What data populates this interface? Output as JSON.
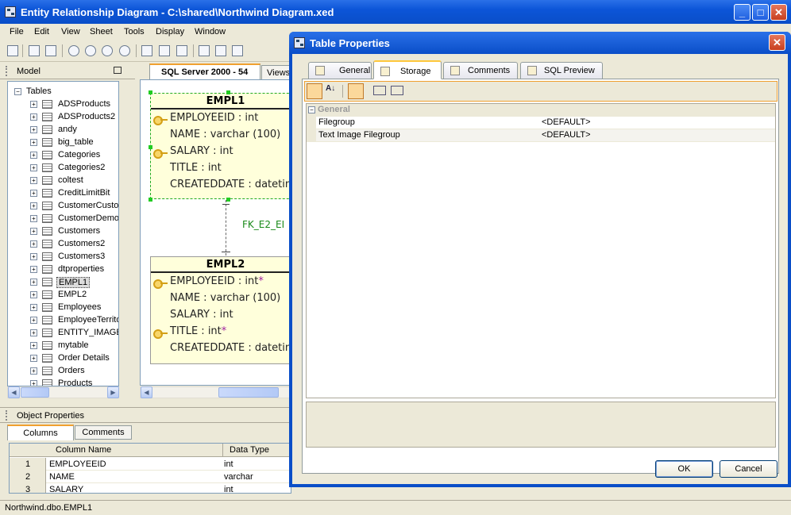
{
  "app": {
    "title": "Entity Relationship Diagram - C:\\shared\\Northwind Diagram.xed",
    "window_controls": [
      "minimize-icon",
      "maximize-icon",
      "close-icon"
    ]
  },
  "menu": [
    "File",
    "Edit",
    "View",
    "Sheet",
    "Tools",
    "Display",
    "Window"
  ],
  "model_panel": {
    "title": "Model",
    "root": "Tables",
    "tables": [
      "ADSProducts",
      "ADSProducts2",
      "andy",
      "big_table",
      "Categories",
      "Categories2",
      "coltest",
      "CreditLimitBit",
      "CustomerCustor",
      "CustomerDemog",
      "Customers",
      "Customers2",
      "Customers3",
      "dtproperties",
      "EMPL1",
      "EMPL2",
      "Employees",
      "EmployeeTerrito",
      "ENTITY_IMAGE",
      "mytable",
      "Order Details",
      "Orders",
      "Products"
    ],
    "selected": "EMPL1"
  },
  "diagram": {
    "tabs": [
      "SQL Server 2000 - 54",
      "Views"
    ],
    "relationship_label": "FK_E2_EI",
    "entities": [
      {
        "name": "EMPL1",
        "columns": [
          {
            "text": "EMPLOYEEID : int",
            "key": true,
            "star": ""
          },
          {
            "text": "NAME : varchar (100)",
            "key": false,
            "star": ""
          },
          {
            "text": "SALARY : int",
            "key": true,
            "star": ""
          },
          {
            "text": "TITLE : int",
            "key": false,
            "star": ""
          },
          {
            "text": "CREATEDDATE : datetim",
            "key": false,
            "star": ""
          }
        ]
      },
      {
        "name": "EMPL2",
        "columns": [
          {
            "text": "EMPLOYEEID : int",
            "key": true,
            "star": "*"
          },
          {
            "text": "NAME : varchar (100)",
            "key": false,
            "star": ""
          },
          {
            "text": "SALARY : int",
            "key": false,
            "star": ""
          },
          {
            "text": "TITLE : int",
            "key": true,
            "star": "*"
          },
          {
            "text": "CREATEDDATE : datetim",
            "key": false,
            "star": ""
          }
        ]
      }
    ]
  },
  "object_properties": {
    "title": "Object Properties",
    "tabs": [
      "Columns",
      "Comments"
    ],
    "headers": [
      "Column Name",
      "Data Type"
    ],
    "rows": [
      {
        "num": "1",
        "name": "EMPLOYEEID",
        "type": "int"
      },
      {
        "num": "2",
        "name": "NAME",
        "type": "varchar"
      },
      {
        "num": "3",
        "name": "SALARY",
        "type": "int"
      }
    ]
  },
  "dialog": {
    "title": "Table Properties",
    "tabs": [
      "General",
      "Storage",
      "Comments",
      "SQL Preview"
    ],
    "selected_tab": "Storage",
    "category": "General",
    "properties": [
      {
        "name": "Filegroup",
        "value": "<DEFAULT>"
      },
      {
        "name": "Text Image Filegroup",
        "value": "<DEFAULT>"
      }
    ],
    "ok_label": "OK",
    "cancel_label": "Cancel"
  },
  "status": {
    "text": "Northwind.dbo.EMPL1"
  }
}
